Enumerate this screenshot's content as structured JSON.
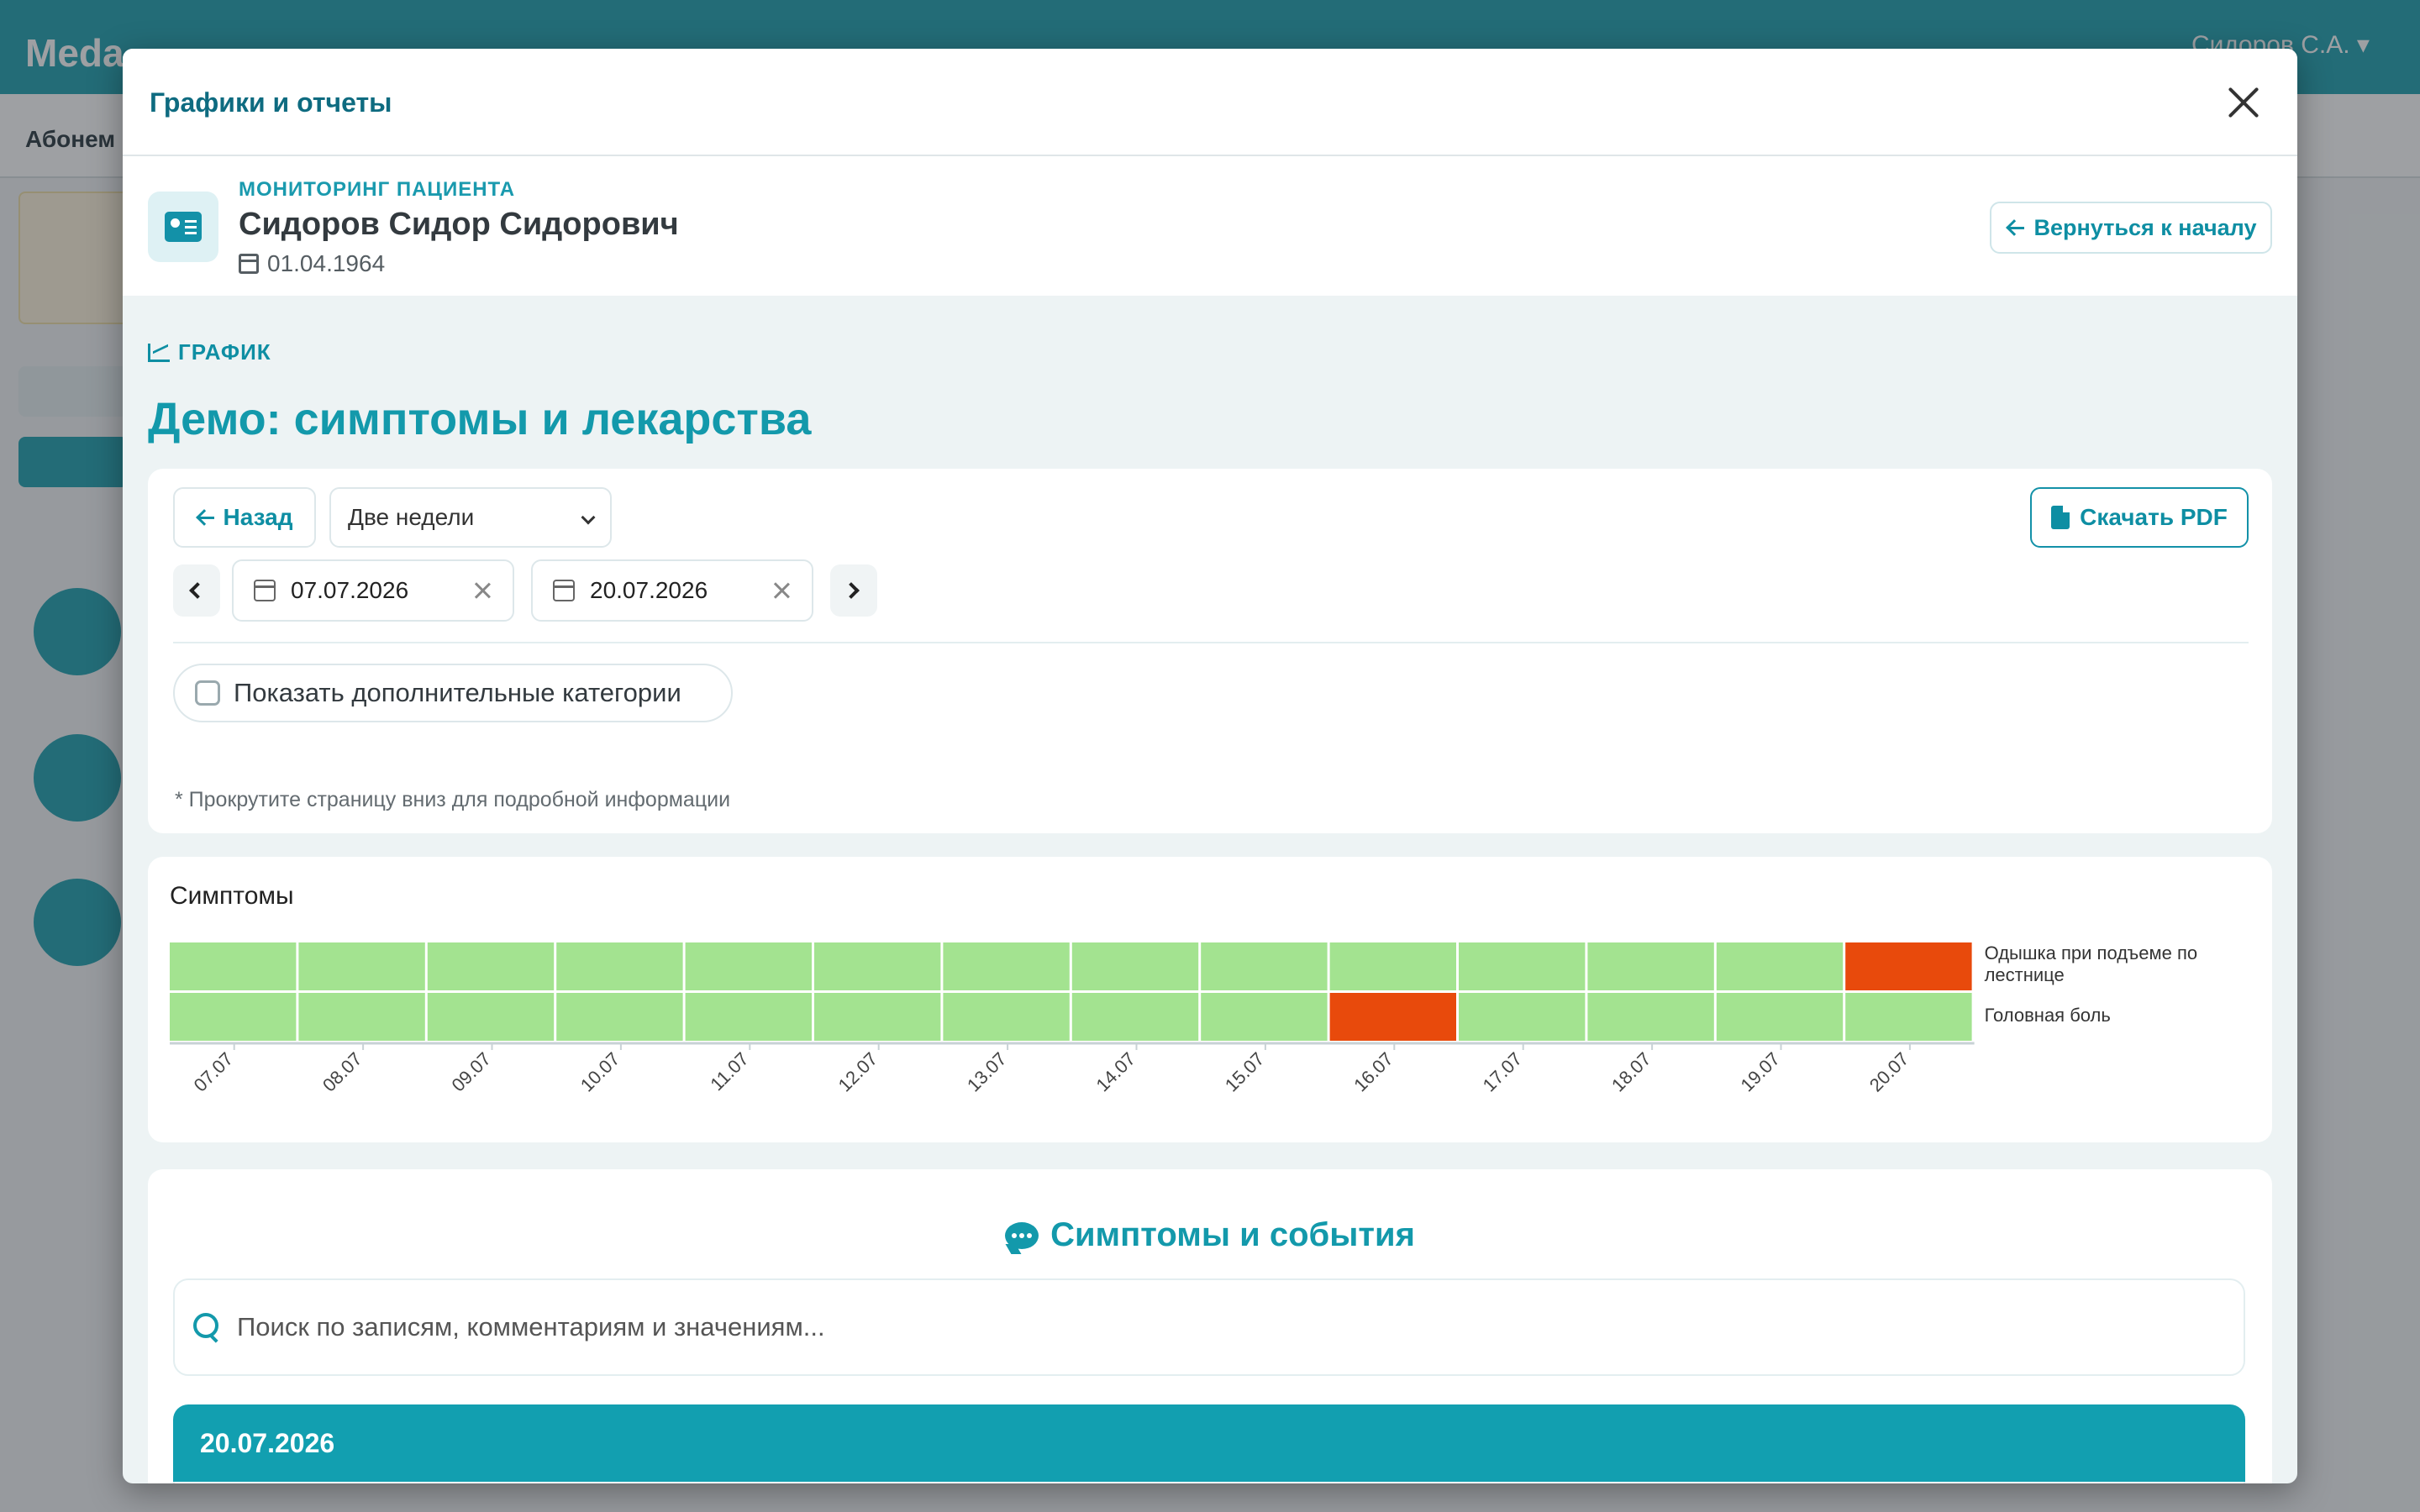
{
  "background": {
    "logo": "Meda",
    "user": "Сидоров С.А. ▾",
    "sub_title": "Абонем"
  },
  "modal": {
    "title": "Графики и отчеты"
  },
  "patient": {
    "label": "МОНИТОРИНГ ПАЦИЕНТА",
    "name": "Сидоров Сидор Сидорович",
    "dob": "01.04.1964",
    "back_to_start": "Вернуться к началу"
  },
  "section": {
    "tag": "ГРАФИК",
    "title": "Демо: симптомы и лекарства"
  },
  "controls": {
    "back_label": "Назад",
    "period_selected": "Две недели",
    "pdf_label": "Скачать PDF",
    "date_from": "07.07.2026",
    "date_to": "20.07.2026",
    "show_extra_label": "Показать дополнительные категории",
    "show_extra_checked": false,
    "hint": "* Прокрутите страницу вниз для подробной информации"
  },
  "symptoms": {
    "title": "Симптомы"
  },
  "chart_data": {
    "type": "heatmap",
    "title": "Симптомы",
    "x": [
      "07.07",
      "08.07",
      "09.07",
      "10.07",
      "11.07",
      "12.07",
      "13.07",
      "14.07",
      "15.07",
      "16.07",
      "17.07",
      "18.07",
      "19.07",
      "20.07"
    ],
    "rows": [
      {
        "name": "Одышка при подъеме по лестнице",
        "values": [
          0,
          0,
          0,
          0,
          0,
          0,
          0,
          0,
          0,
          0,
          0,
          0,
          0,
          1
        ]
      },
      {
        "name": "Головная боль",
        "values": [
          0,
          0,
          0,
          0,
          0,
          0,
          0,
          0,
          0,
          1,
          0,
          0,
          0,
          0
        ]
      }
    ],
    "colors": {
      "absent": "#a3e390",
      "present": "#e84a0c"
    },
    "grid": true,
    "legend": "right"
  },
  "events": {
    "title": "Симптомы и события",
    "search_placeholder": "Поиск по записям, комментариям и значениям...",
    "days": [
      {
        "date": "20.07.2026"
      }
    ]
  }
}
